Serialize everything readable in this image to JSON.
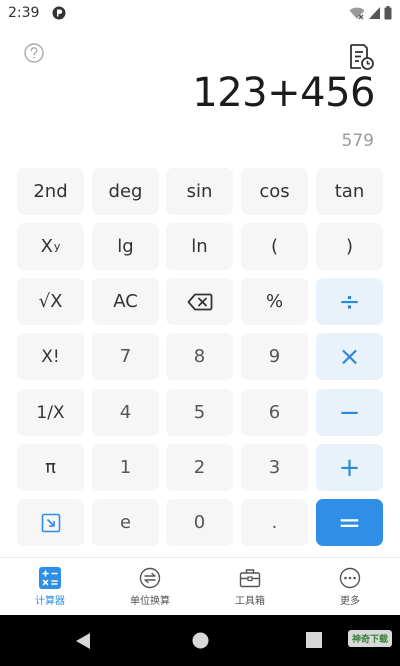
{
  "status_bar": {
    "time": "2:39"
  },
  "display": {
    "expression": "123+456",
    "result": "579"
  },
  "keys": {
    "second": "2nd",
    "deg": "deg",
    "sin": "sin",
    "cos": "cos",
    "tan": "tan",
    "xy_base": "X",
    "xy_exp": "y",
    "lg": "lg",
    "ln": "ln",
    "lparen": "(",
    "rparen": ")",
    "sqrt": "√X",
    "ac": "AC",
    "percent": "%",
    "divide": "÷",
    "factorial": "X!",
    "seven": "7",
    "eight": "8",
    "nine": "9",
    "multiply": "×",
    "reciprocal": "1/X",
    "four": "4",
    "five": "5",
    "six": "6",
    "minus": "−",
    "pi": "π",
    "one": "1",
    "two": "2",
    "three": "3",
    "plus": "+",
    "e": "e",
    "zero": "0",
    "dot": ".",
    "equals": "="
  },
  "bottom_nav": {
    "calculator": "计算器",
    "unit_conversion": "单位换算",
    "toolbox": "工具箱",
    "more": "更多"
  },
  "watermark": "神奇下载",
  "colors": {
    "accent": "#2f8ee6",
    "op_bg": "#e9f2fb",
    "key_bg": "#f6f6f7"
  }
}
